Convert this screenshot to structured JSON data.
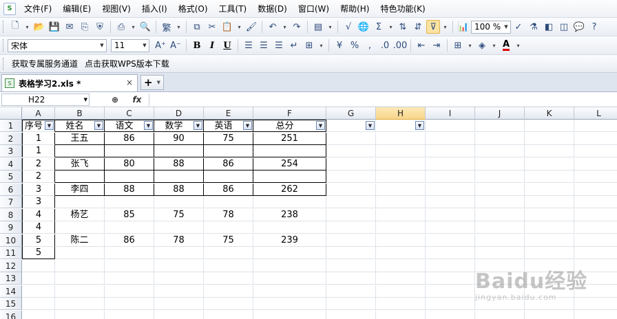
{
  "menu": {
    "app_icon": "wps-et-icon",
    "items": [
      "文件(F)",
      "编辑(E)",
      "视图(V)",
      "插入(I)",
      "格式(O)",
      "工具(T)",
      "数据(D)",
      "窗口(W)",
      "帮助(H)",
      "特色功能(K)"
    ]
  },
  "toolbar1": {
    "zoom": "100 %"
  },
  "toolbar2": {
    "font_name": "宋体",
    "font_size": "11",
    "font_color": "#d90000"
  },
  "infobar": {
    "link1": "获取专属服务通道",
    "link2": "点击获取WPS版本下载"
  },
  "tabs": {
    "doc_title": "表格学习2.xls *",
    "close_glyph": "×",
    "new_glyph": "+"
  },
  "formula_bar": {
    "cell_ref": "H22",
    "fx_label": "fx",
    "value": ""
  },
  "sheet": {
    "columns": [
      "A",
      "B",
      "C",
      "D",
      "E",
      "F",
      "G",
      "H",
      "I",
      "J",
      "K",
      "L"
    ],
    "selected_column": "H",
    "rows": [
      "1",
      "2",
      "3",
      "4",
      "5",
      "6",
      "7",
      "8",
      "9",
      "10",
      "11",
      "12",
      "13",
      "14",
      "15",
      "16"
    ],
    "header_row": [
      "序号",
      "姓名",
      "语文",
      "数学",
      "英语",
      "总分"
    ],
    "data": [
      [
        "1",
        "王五",
        "86",
        "90",
        "75",
        "251"
      ],
      [
        "1",
        "",
        "",
        "",
        "",
        ""
      ],
      [
        "2",
        "张飞",
        "80",
        "88",
        "86",
        "254"
      ],
      [
        "2",
        "",
        "",
        "",
        "",
        ""
      ],
      [
        "3",
        "李四",
        "88",
        "88",
        "86",
        "262"
      ],
      [
        "3",
        "",
        "",
        "",
        "",
        ""
      ],
      [
        "4",
        "杨艺",
        "85",
        "75",
        "78",
        "238"
      ],
      [
        "4",
        "",
        "",
        "",
        "",
        ""
      ],
      [
        "5",
        "陈二",
        "86",
        "78",
        "75",
        "239"
      ],
      [
        "5",
        "",
        "",
        "",
        "",
        ""
      ]
    ]
  },
  "watermark": {
    "main": "Baidu经验",
    "sub": "jingyan.baidu.com"
  }
}
